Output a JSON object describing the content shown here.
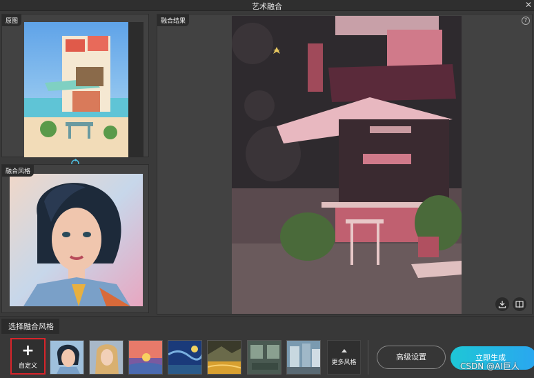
{
  "window": {
    "title": "艺术融合"
  },
  "original_panel": {
    "label": "原图"
  },
  "style_panel": {
    "label": "融合风格"
  },
  "result_panel": {
    "label": "融合结果",
    "help": "?"
  },
  "bottom": {
    "select_label": "选择融合风格",
    "custom_label": "自定义",
    "more_label": "更多风格",
    "advanced_label": "高级设置",
    "generate_label": "立即生成"
  },
  "thumbnails": [
    {
      "name": "portrait-woman-curly",
      "selected": true
    },
    {
      "name": "portrait-woman-blonde"
    },
    {
      "name": "sunset-landscape"
    },
    {
      "name": "starry-night"
    },
    {
      "name": "golden-river"
    },
    {
      "name": "interior-room"
    },
    {
      "name": "city-street"
    }
  ],
  "watermark": "CSDN @AI巨人",
  "colors": {
    "accent": "#27b5e6",
    "custom_border": "#d8242a"
  }
}
